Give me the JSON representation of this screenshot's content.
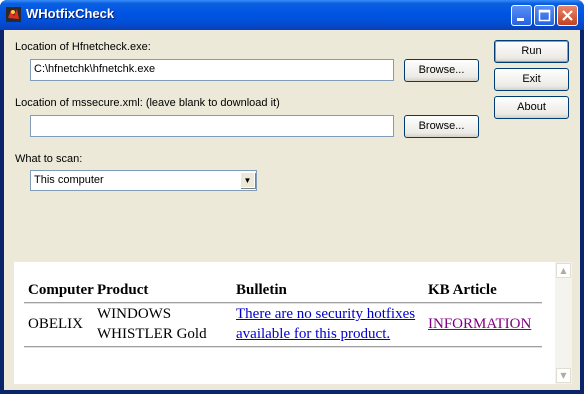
{
  "window": {
    "title": "WHotfixCheck"
  },
  "form": {
    "hfnet_label": "Location of Hfnetcheck.exe:",
    "hfnet_value": "C:\\hfnetchk\\hfnetchk.exe",
    "mssecure_label": "Location of mssecure.xml: (leave blank to download it)",
    "mssecure_value": "",
    "scan_label": "What to scan:",
    "scan_value": "This computer",
    "browse_label": "Browse..."
  },
  "buttons": {
    "run": "Run",
    "exit": "Exit",
    "about": "About"
  },
  "results": {
    "headers": [
      "Computer",
      "Product",
      "Bulletin",
      "KB Article"
    ],
    "rows": [
      {
        "computer": "OBELIX",
        "product_line1": "WINDOWS",
        "product_line2": "WHISTLER Gold",
        "bulletin_line1": "There are no security hotfixes",
        "bulletin_line2": "available for this product.",
        "kb": "INFORMATION"
      }
    ]
  },
  "colors": {
    "titlebar": "#0054e3",
    "client": "#ece9d8",
    "link": "#0000cc",
    "visited": "#800080"
  }
}
